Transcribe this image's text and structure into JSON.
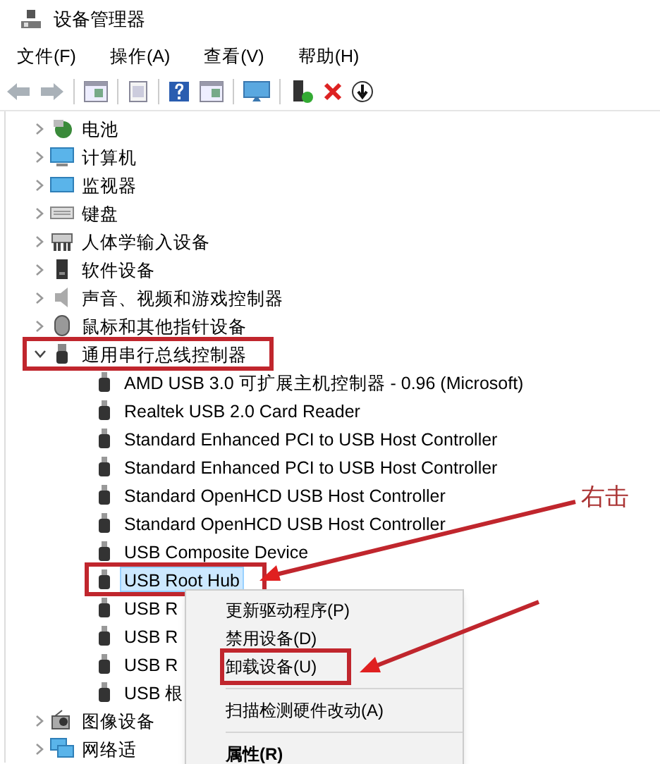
{
  "window": {
    "title": "设备管理器"
  },
  "menu_bar": [
    "文件(F)",
    "操作(A)",
    "查看(V)",
    "帮助(H)"
  ],
  "tree": [
    {
      "label": "电池",
      "expanded": false,
      "selected": false,
      "marked": false
    },
    {
      "label": "计算机",
      "expanded": false,
      "selected": false,
      "marked": false
    },
    {
      "label": "监视器",
      "expanded": false,
      "selected": false,
      "marked": false
    },
    {
      "label": "键盘",
      "expanded": false,
      "selected": false,
      "marked": false
    },
    {
      "label": "人体学输入设备",
      "expanded": false,
      "selected": false,
      "marked": false
    },
    {
      "label": "软件设备",
      "expanded": false,
      "selected": false,
      "marked": false
    },
    {
      "label": "声音、视频和游戏控制器",
      "expanded": false,
      "selected": false,
      "marked": false
    },
    {
      "label": "鼠标和其他指针设备",
      "expanded": false,
      "selected": false,
      "marked": false
    },
    {
      "label": "通用串行总线控制器",
      "expanded": true,
      "selected": false,
      "marked": true,
      "children": [
        {
          "label": "AMD USB 3.0 可扩展主机控制器 - 0.96 (Microsoft)",
          "selected": false,
          "marked": false
        },
        {
          "label": "Realtek USB 2.0 Card Reader",
          "selected": false,
          "marked": false
        },
        {
          "label": "Standard Enhanced PCI to USB Host Controller",
          "selected": false,
          "marked": false
        },
        {
          "label": "Standard Enhanced PCI to USB Host Controller",
          "selected": false,
          "marked": false
        },
        {
          "label": "Standard OpenHCD USB Host Controller",
          "selected": false,
          "marked": false
        },
        {
          "label": "Standard OpenHCD USB Host Controller",
          "selected": false,
          "marked": false
        },
        {
          "label": "USB Composite Device",
          "selected": false,
          "marked": false
        },
        {
          "label": "USB Root Hub",
          "selected": true,
          "marked": true
        },
        {
          "label": "USB R",
          "selected": false,
          "marked": false
        },
        {
          "label": "USB R",
          "selected": false,
          "marked": false
        },
        {
          "label": "USB R",
          "selected": false,
          "marked": false
        },
        {
          "label": "USB 根",
          "selected": false,
          "marked": false
        }
      ]
    },
    {
      "label": "图像设备",
      "expanded": false,
      "selected": false,
      "marked": false
    },
    {
      "label": "网络适",
      "expanded": false,
      "selected": false,
      "marked": false
    }
  ],
  "context_menu": [
    {
      "kind": "item",
      "label": "更新驱动程序(P)",
      "default": false,
      "marked": false
    },
    {
      "kind": "item",
      "label": "禁用设备(D)",
      "default": false,
      "marked": false
    },
    {
      "kind": "item",
      "label": "卸载设备(U)",
      "default": false,
      "marked": true
    },
    {
      "kind": "separator"
    },
    {
      "kind": "item",
      "label": "扫描检测硬件改动(A)",
      "default": false,
      "marked": false
    },
    {
      "kind": "separator"
    },
    {
      "kind": "item",
      "label": "属性(R)",
      "default": true,
      "marked": false
    }
  ],
  "callout": "右击"
}
